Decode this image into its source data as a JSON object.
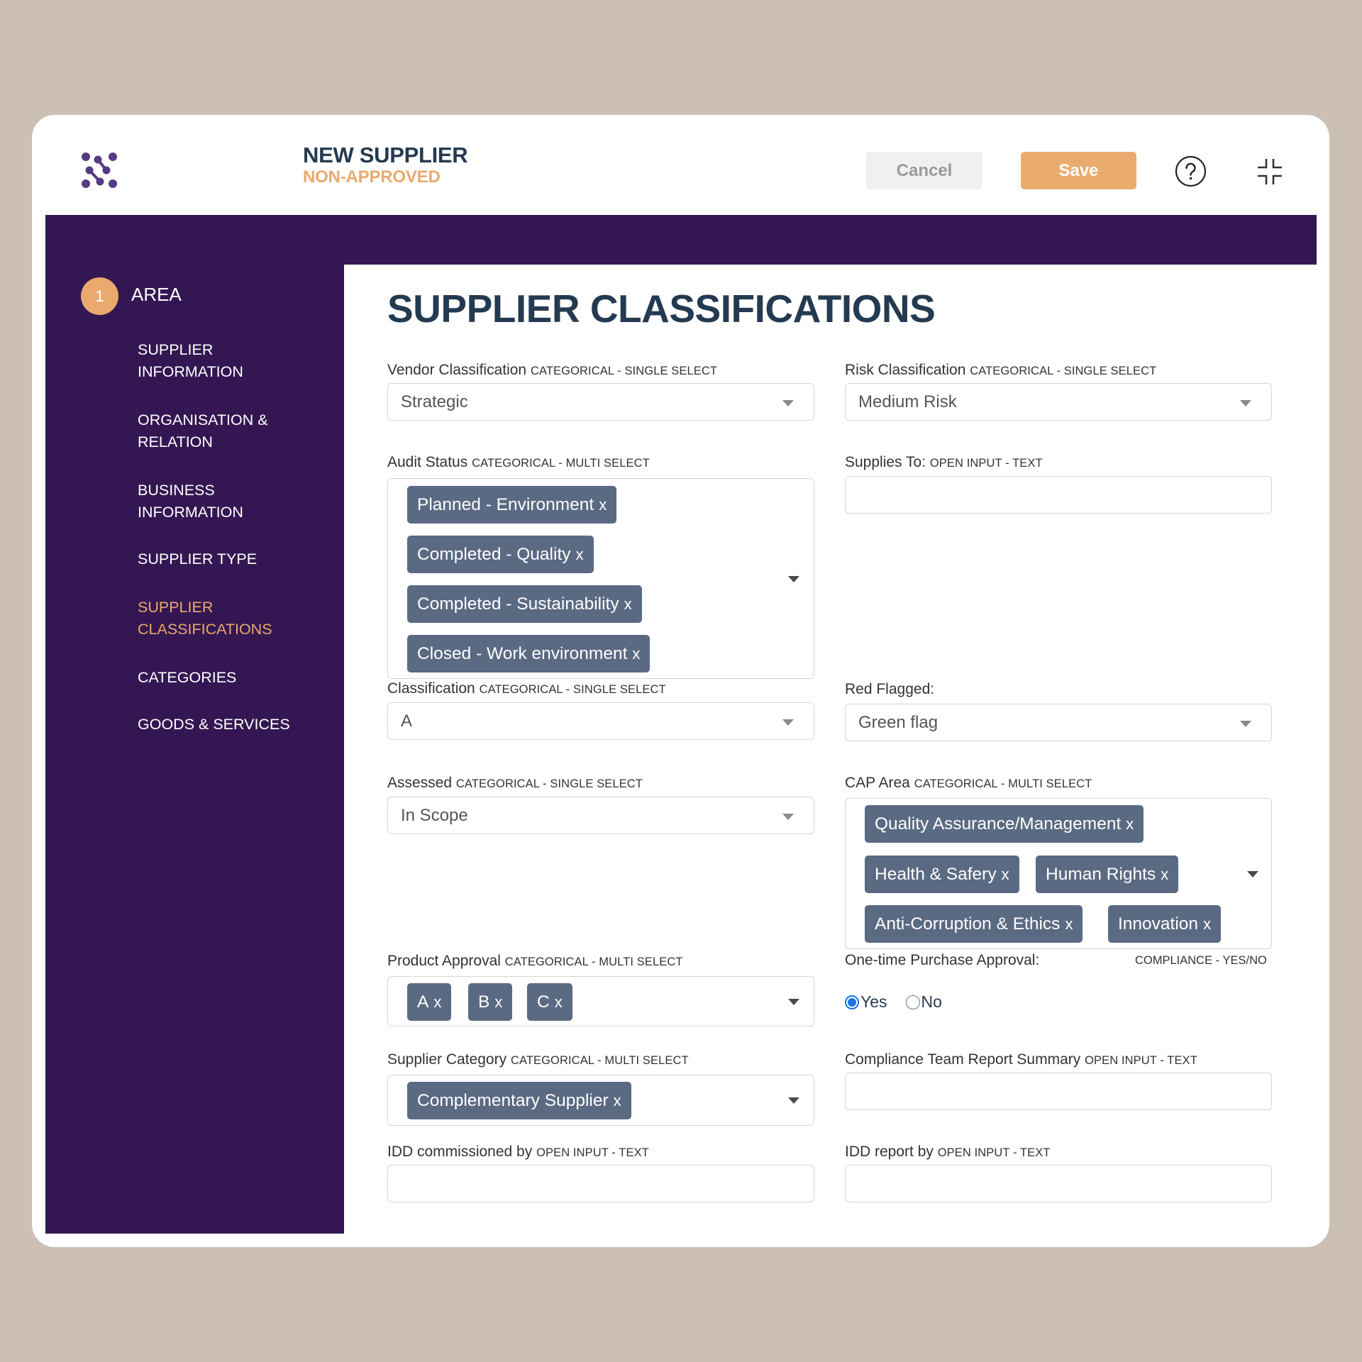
{
  "header": {
    "title": "NEW SUPPLIER",
    "status": "NON-APPROVED",
    "cancel_label": "Cancel",
    "save_label": "Save",
    "help_icon": "help-circle-icon",
    "compress_icon": "compress-icon",
    "logo_icon": "connected-dots-logo"
  },
  "sidebar": {
    "step_number": "1",
    "step_label": "AREA",
    "items": [
      {
        "label": "SUPPLIER\nINFORMATION",
        "active": false
      },
      {
        "label": "ORGANISATION &\nRELATION",
        "active": false
      },
      {
        "label": "BUSINESS\nINFORMATION",
        "active": false
      },
      {
        "label": "SUPPLIER TYPE",
        "active": false
      },
      {
        "label": "SUPPLIER\nCLASSIFICATIONS",
        "active": true
      },
      {
        "label": "CATEGORIES",
        "active": false
      },
      {
        "label": "GOODS & SERVICES",
        "active": false
      }
    ]
  },
  "colors": {
    "brand_purple": "#341752",
    "accent_orange": "#eaa96d",
    "chip": "#5b6a83",
    "heading": "#243a50",
    "radio_selected": "#1a73e8"
  },
  "main": {
    "heading": "SUPPLIER CLASSIFICATIONS",
    "fields": {
      "vendor_classification": {
        "label": "Vendor Classification",
        "hint": "CATEGORICAL - SINGLE SELECT",
        "value": "Strategic"
      },
      "risk_classification": {
        "label": "Risk Classification",
        "hint": "CATEGORICAL - SINGLE SELECT",
        "value": "Medium Risk"
      },
      "audit_status": {
        "label": "Audit Status",
        "hint": "CATEGORICAL - MULTI SELECT",
        "chips": [
          "Planned - Environment",
          "Completed - Quality",
          "Completed - Sustainability",
          "Closed - Work environment"
        ]
      },
      "supplies_to": {
        "label": "Supplies To:",
        "hint": "OPEN INPUT - TEXT",
        "value": ""
      },
      "classification": {
        "label": "Classification",
        "hint": "CATEGORICAL - SINGLE SELECT",
        "value": "A"
      },
      "red_flagged": {
        "label": "Red Flagged:",
        "value": "Green flag"
      },
      "assessed": {
        "label": "Assessed",
        "hint": "CATEGORICAL - SINGLE SELECT",
        "value": "In Scope"
      },
      "cap_area": {
        "label": "CAP Area",
        "hint": "CATEGORICAL - MULTI SELECT",
        "chips": [
          "Quality Assurance/Management",
          "Health & Safery",
          "Human Rights",
          "Anti-Corruption & Ethics",
          "Innovation"
        ]
      },
      "product_approval": {
        "label": "Product Approval",
        "hint": "CATEGORICAL - MULTI SELECT",
        "chips": [
          "A",
          "B",
          "C"
        ]
      },
      "one_time_purchase": {
        "label": "One-time Purchase Approval:",
        "hint": "COMPLIANCE - YES/NO",
        "options": [
          "Yes",
          "No"
        ],
        "selected": "Yes"
      },
      "supplier_category": {
        "label": "Supplier Category",
        "hint": "CATEGORICAL - MULTI SELECT",
        "chips": [
          "Complementary Supplier"
        ]
      },
      "compliance_summary": {
        "label": "Compliance Team Report Summary",
        "hint": "OPEN INPUT - TEXT",
        "value": ""
      },
      "idd_commissioned_by": {
        "label": "IDD commissioned by",
        "hint": "OPEN INPUT - TEXT",
        "value": ""
      },
      "idd_report_by": {
        "label": "IDD report by",
        "hint": "OPEN INPUT - TEXT",
        "value": ""
      }
    },
    "chip_remove_glyph": "x"
  }
}
